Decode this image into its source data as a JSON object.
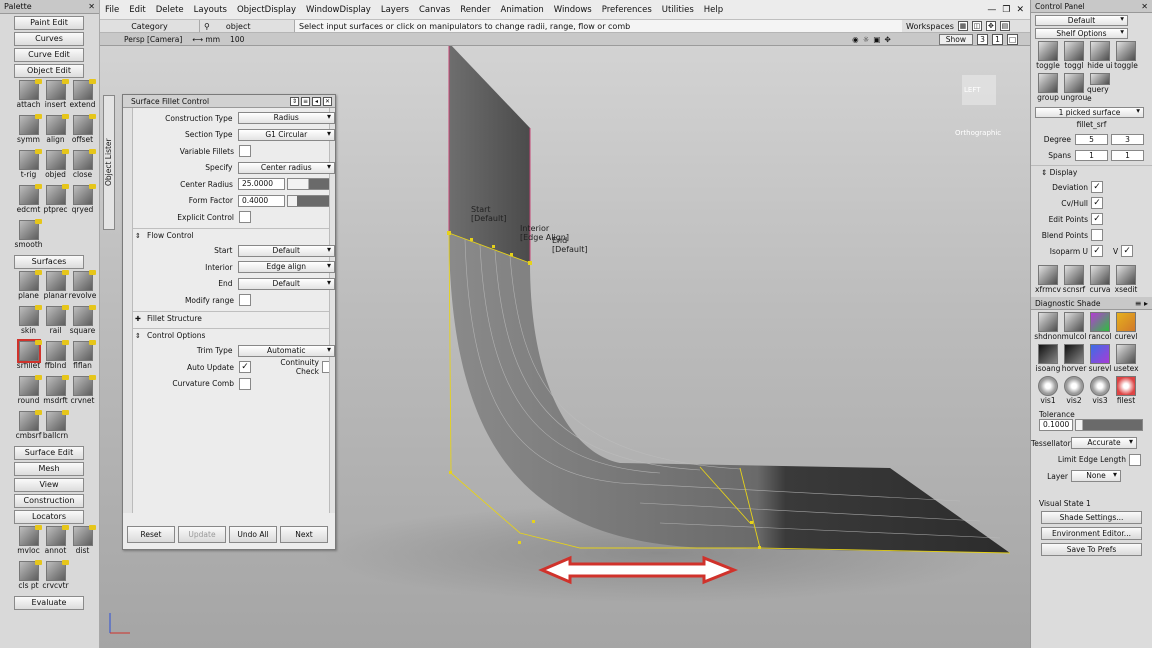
{
  "menu": [
    "File",
    "Edit",
    "Delete",
    "Layouts",
    "ObjectDisplay",
    "WindowDisplay",
    "Layers",
    "Canvas",
    "Render",
    "Animation",
    "Windows",
    "Preferences",
    "Utilities",
    "Help"
  ],
  "toolbar2": {
    "category": "Category",
    "object": "object",
    "hint": "Select input surfaces or click on manipulators to change radii, range, flow or comb",
    "workspaces": "Workspaces"
  },
  "palette": {
    "title": "Palette",
    "paint_edit": "Paint Edit",
    "curves": "Curves",
    "curve_edit": "Curve Edit",
    "object_edit": "Object Edit",
    "object_tools": [
      "attach",
      "insert",
      "extend",
      "symm",
      "align",
      "offset",
      "t-rig",
      "objed",
      "close",
      "edcmt",
      "ptprec",
      "qryed",
      "smooth"
    ],
    "surfaces": "Surfaces",
    "surface_tools": [
      "plane",
      "planar",
      "revolve",
      "skin",
      "rail",
      "square",
      "srfillet",
      "ffblnd",
      "flflan",
      "round",
      "msdrft",
      "crvnet",
      "cmbsrf",
      "ballcrn"
    ],
    "surface_edit": "Surface Edit",
    "mesh": "Mesh",
    "view": "View",
    "construction": "Construction",
    "locators": "Locators",
    "locator_tools": [
      "mvloc",
      "annot",
      "dist",
      "cls pt",
      "crvcvtr"
    ],
    "evaluate": "Evaluate"
  },
  "object_lister": "Object Lister",
  "viewport": {
    "camera": "Persp [Camera]",
    "units": "⟷ mm",
    "zoom": "100",
    "show": "Show",
    "num3": "3",
    "num1": "1",
    "cube_label": "LEFT",
    "ortho": "Orthographic"
  },
  "fillet": {
    "title": "Surface Fillet Control",
    "construction_type_label": "Construction Type",
    "construction_type": "Radius",
    "section_type_label": "Section Type",
    "section_type": "G1 Circular",
    "variable_fillets_label": "Variable Fillets",
    "specify_label": "Specify",
    "specify": "Center radius",
    "center_radius_label": "Center Radius",
    "center_radius": "25.0000",
    "form_factor_label": "Form Factor",
    "form_factor": "0.4000",
    "explicit_control_label": "Explicit Control",
    "flow_control": "Flow Control",
    "start_label": "Start",
    "start": "Default",
    "interior_label": "Interior",
    "interior": "Edge align",
    "end_label": "End",
    "end": "Default",
    "modify_range_label": "Modify range",
    "fillet_structure": "Fillet Structure",
    "control_options": "Control Options",
    "trim_type_label": "Trim Type",
    "trim_type": "Automatic",
    "auto_update_label": "Auto Update",
    "continuity_check_label": "Continuity Check",
    "curvature_comb_label": "Curvature Comb",
    "reset": "Reset",
    "update": "Update",
    "undo_all": "Undo All",
    "next": "Next"
  },
  "annotations": {
    "start": "Start",
    "start_default": "[Default]",
    "interior": "Interior",
    "interior_edge": "[Edge Align]",
    "end": "End",
    "end_default": "[Default]"
  },
  "control_panel": {
    "title": "Control Panel",
    "layout": "Default",
    "shelf_options": "Shelf Options",
    "shelf_tools": [
      "toggle",
      "toggl",
      "hide ui",
      "toggle",
      "group",
      "ungrou",
      "query e"
    ],
    "picked": "1 picked surface",
    "name": "fillet_srf",
    "degree_label": "Degree",
    "degree_u": "5",
    "degree_v": "3",
    "spans_label": "Spans",
    "spans_u": "1",
    "spans_v": "1",
    "display": "Display",
    "deviation": "Deviation",
    "cv_hull": "Cv/Hull",
    "edit_points": "Edit Points",
    "blend_points": "Blend Points",
    "isoparm_u": "Isoparm U",
    "isoparm_v": "V",
    "tools2": [
      "xfrmcv",
      "scnsrf",
      "curva",
      "xsedit"
    ],
    "diagnostic_shade": "Diagnostic Shade",
    "diag_tools": [
      "shdnon",
      "mulcol",
      "rancol",
      "curevl",
      "isoang",
      "horver",
      "surevl",
      "usetex",
      "vis1",
      "vis2",
      "vis3",
      "filest"
    ],
    "tolerance_label": "Tolerance",
    "tolerance": "0.1000",
    "tessellator_label": "Tessellator",
    "tessellator": "Accurate",
    "limit_edge_length": "Limit Edge Length",
    "layer_label": "Layer",
    "layer": "None",
    "visual_state": "Visual State 1",
    "shade_settings": "Shade Settings...",
    "environment_editor": "Environment Editor...",
    "save_to_prefs": "Save To Prefs"
  },
  "colors": {
    "accent_red": "#d0322b",
    "surface_dark": "#3a3a3a",
    "highlight_yellow": "#e6d21a"
  }
}
